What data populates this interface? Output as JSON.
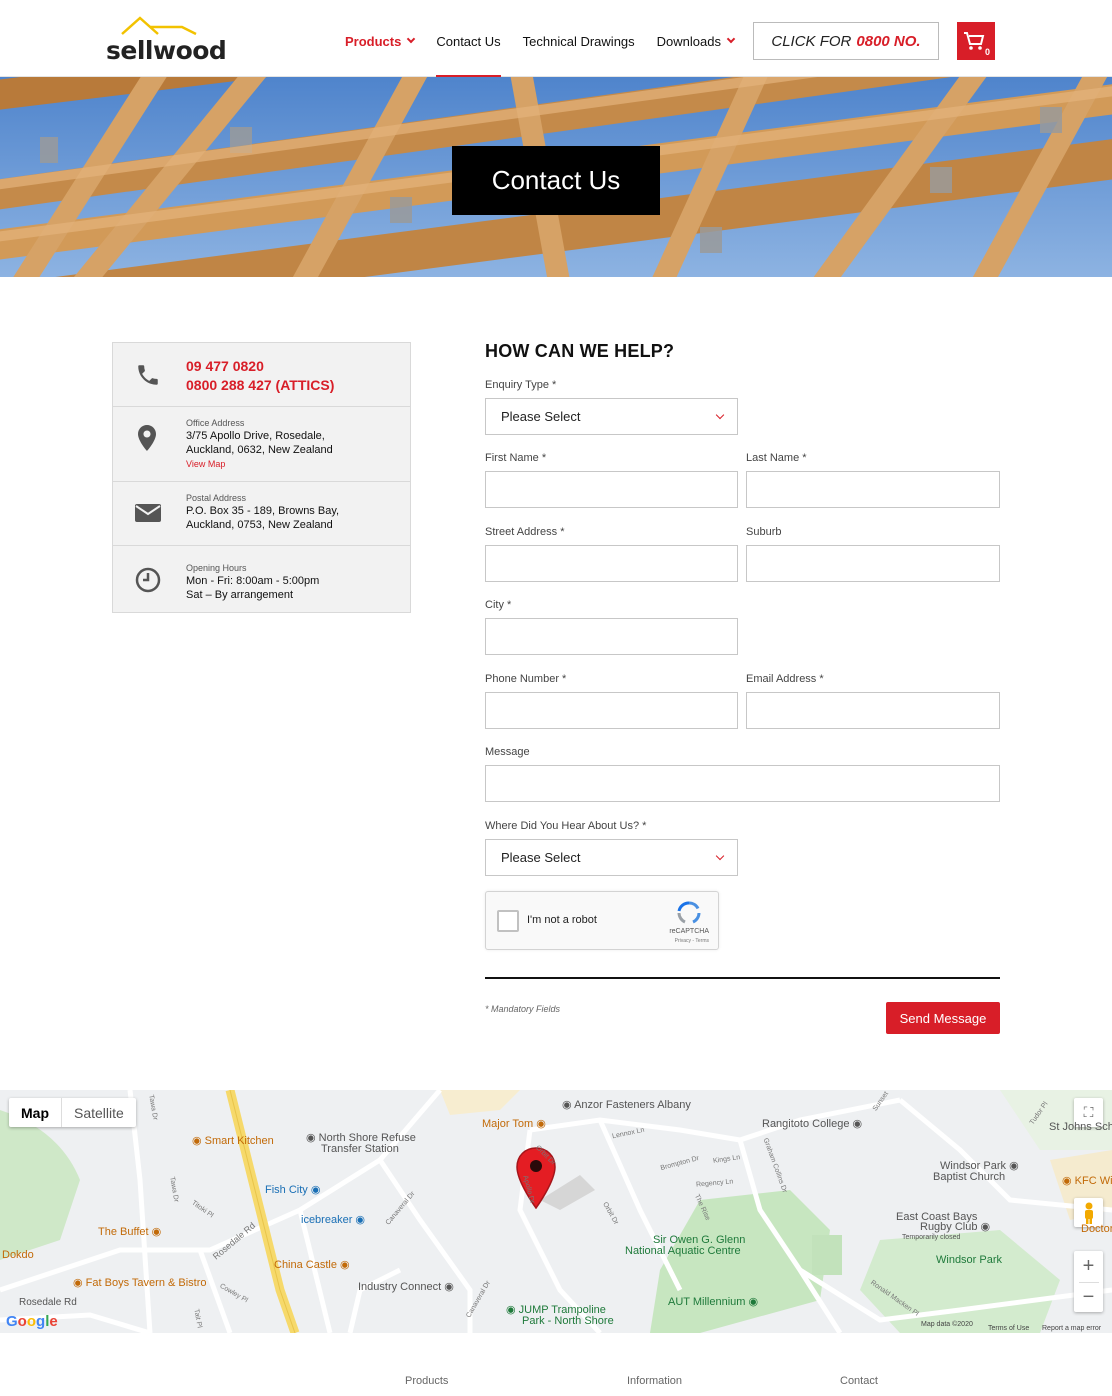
{
  "header": {
    "logo_text": "sellwood",
    "nav": [
      {
        "label": "Products",
        "has_dropdown": true
      },
      {
        "label": "Contact Us",
        "has_dropdown": false
      },
      {
        "label": "Technical Drawings",
        "has_dropdown": false
      },
      {
        "label": "Downloads",
        "has_dropdown": true
      }
    ],
    "call_prefix": "CLICK FOR",
    "call_number": "0800 NO.",
    "cart_count": "0",
    "accent_color": "#d81e28"
  },
  "hero": {
    "title": "Contact Us"
  },
  "contact": {
    "phone_1": "09 477 0820",
    "phone_2": "0800 288 427 (ATTICS)",
    "office_label": "Office Address",
    "office_line_1": "3/75 Apollo Drive, Rosedale,",
    "office_line_2": "Auckland, 0632, New Zealand",
    "view_map": "View Map",
    "postal_label": "Postal Address",
    "postal_line_1": "P.O. Box 35 - 189, Browns Bay,",
    "postal_line_2": "Auckland, 0753, New Zealand",
    "hours_label": "Opening Hours",
    "hours_line_1": "Mon - Fri: 8:00am - 5:00pm",
    "hours_line_2": "Sat – By arrangement"
  },
  "form": {
    "title": "HOW CAN WE HELP?",
    "enquiry_label": "Enquiry Type *",
    "enquiry_value": "Please Select",
    "first_name_label": "First Name *",
    "last_name_label": "Last Name *",
    "street_label": "Street Address *",
    "suburb_label": "Suburb",
    "city_label": "City *",
    "phone_label": "Phone Number *",
    "email_label": "Email Address *",
    "message_label": "Message",
    "hear_label": "Where Did You Hear About Us? *",
    "hear_value": "Please Select",
    "captcha_text": "I'm not a robot",
    "captcha_brand": "reCAPTCHA",
    "captcha_privacy": "Privacy - Terms",
    "mandatory_note": "* Mandatory Fields",
    "send_label": "Send Message"
  },
  "map": {
    "tab_map": "Map",
    "tab_satellite": "Satellite",
    "places": [
      "Anzor Fasteners Albany",
      "Major Tom",
      "Rangitoto College",
      "St Johns Sch",
      "Smart Kitchen",
      "North Shore Refuse",
      "Transfer Station",
      "Windsor Park",
      "Baptist Church",
      "KFC Wi",
      "Fish City",
      "icebreaker",
      "East Coast Bays",
      "Rugby Club",
      "Temporarily closed",
      "The Buffet",
      "Sir Owen G. Glenn",
      "National Aquatic Centre",
      "Dokdo",
      "China Castle",
      "Windsor Park",
      "Fat Boys Tavern & Bistro",
      "Industry Connect",
      "JUMP Trampoline",
      "Park - North Shore",
      "AUT Millennium",
      "Rosedale Rd",
      "Doctor"
    ],
    "roads": [
      "Tawa Dr",
      "Titoki Pl",
      "Rosedale Rd",
      "Canaveral Dr",
      "Orbit Dr",
      "Lennox Ln",
      "Brompton Dr",
      "Kings Ln",
      "Regency Ln",
      "The Rise",
      "Graham Collins Dr",
      "Cowley Pl",
      "Tait Pl",
      "Sunset",
      "Tudor Pl",
      "Ronald Macken Pl",
      "Apollo Dr"
    ],
    "map_data": "Map data ©2020",
    "terms": "Terms of Use",
    "report": "Report a map error",
    "google": "Google"
  },
  "footer": {
    "col_1": "Products",
    "col_2": "Information",
    "col_3": "Contact"
  }
}
